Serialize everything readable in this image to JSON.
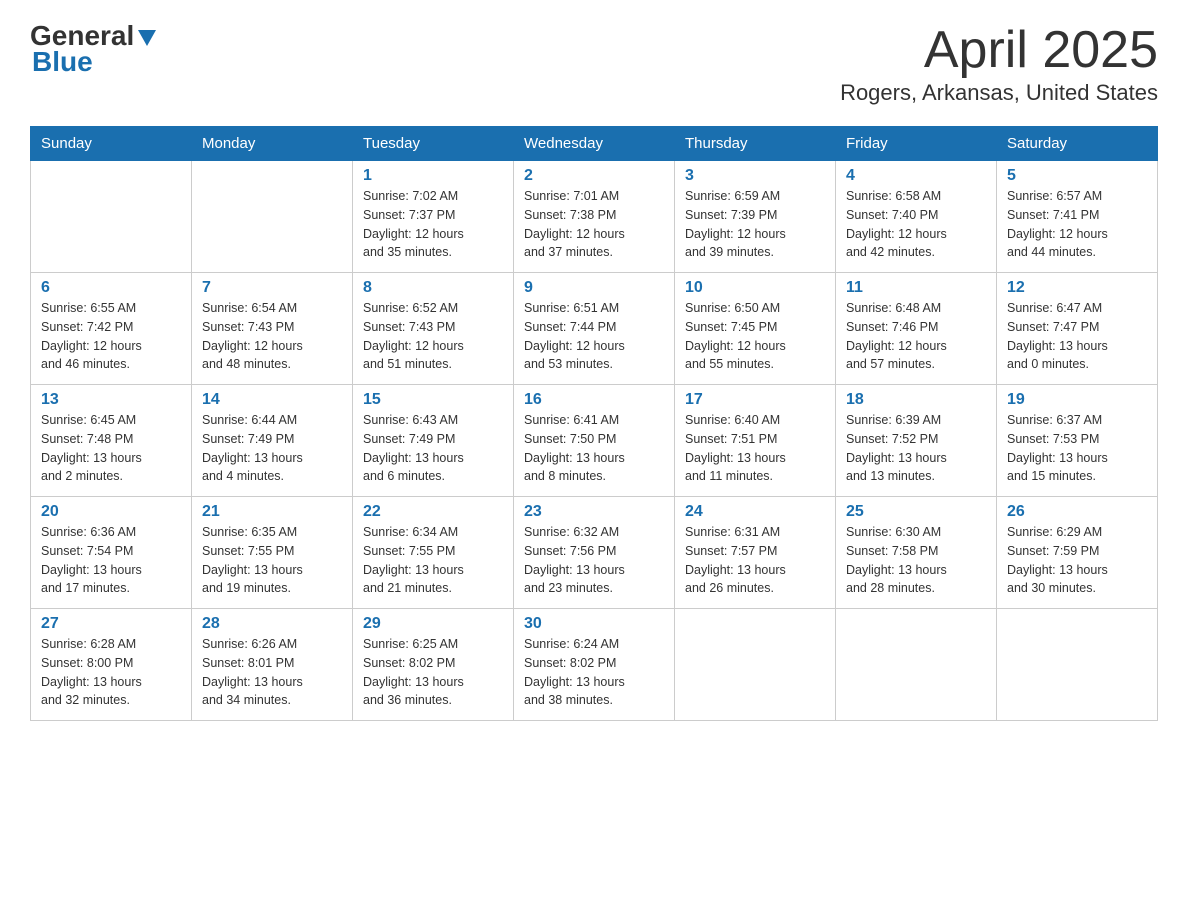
{
  "header": {
    "logo_general": "General",
    "logo_blue": "Blue",
    "month_title": "April 2025",
    "location": "Rogers, Arkansas, United States"
  },
  "days_of_week": [
    "Sunday",
    "Monday",
    "Tuesday",
    "Wednesday",
    "Thursday",
    "Friday",
    "Saturday"
  ],
  "weeks": [
    [
      {
        "day": "",
        "info": ""
      },
      {
        "day": "",
        "info": ""
      },
      {
        "day": "1",
        "info": "Sunrise: 7:02 AM\nSunset: 7:37 PM\nDaylight: 12 hours\nand 35 minutes."
      },
      {
        "day": "2",
        "info": "Sunrise: 7:01 AM\nSunset: 7:38 PM\nDaylight: 12 hours\nand 37 minutes."
      },
      {
        "day": "3",
        "info": "Sunrise: 6:59 AM\nSunset: 7:39 PM\nDaylight: 12 hours\nand 39 minutes."
      },
      {
        "day": "4",
        "info": "Sunrise: 6:58 AM\nSunset: 7:40 PM\nDaylight: 12 hours\nand 42 minutes."
      },
      {
        "day": "5",
        "info": "Sunrise: 6:57 AM\nSunset: 7:41 PM\nDaylight: 12 hours\nand 44 minutes."
      }
    ],
    [
      {
        "day": "6",
        "info": "Sunrise: 6:55 AM\nSunset: 7:42 PM\nDaylight: 12 hours\nand 46 minutes."
      },
      {
        "day": "7",
        "info": "Sunrise: 6:54 AM\nSunset: 7:43 PM\nDaylight: 12 hours\nand 48 minutes."
      },
      {
        "day": "8",
        "info": "Sunrise: 6:52 AM\nSunset: 7:43 PM\nDaylight: 12 hours\nand 51 minutes."
      },
      {
        "day": "9",
        "info": "Sunrise: 6:51 AM\nSunset: 7:44 PM\nDaylight: 12 hours\nand 53 minutes."
      },
      {
        "day": "10",
        "info": "Sunrise: 6:50 AM\nSunset: 7:45 PM\nDaylight: 12 hours\nand 55 minutes."
      },
      {
        "day": "11",
        "info": "Sunrise: 6:48 AM\nSunset: 7:46 PM\nDaylight: 12 hours\nand 57 minutes."
      },
      {
        "day": "12",
        "info": "Sunrise: 6:47 AM\nSunset: 7:47 PM\nDaylight: 13 hours\nand 0 minutes."
      }
    ],
    [
      {
        "day": "13",
        "info": "Sunrise: 6:45 AM\nSunset: 7:48 PM\nDaylight: 13 hours\nand 2 minutes."
      },
      {
        "day": "14",
        "info": "Sunrise: 6:44 AM\nSunset: 7:49 PM\nDaylight: 13 hours\nand 4 minutes."
      },
      {
        "day": "15",
        "info": "Sunrise: 6:43 AM\nSunset: 7:49 PM\nDaylight: 13 hours\nand 6 minutes."
      },
      {
        "day": "16",
        "info": "Sunrise: 6:41 AM\nSunset: 7:50 PM\nDaylight: 13 hours\nand 8 minutes."
      },
      {
        "day": "17",
        "info": "Sunrise: 6:40 AM\nSunset: 7:51 PM\nDaylight: 13 hours\nand 11 minutes."
      },
      {
        "day": "18",
        "info": "Sunrise: 6:39 AM\nSunset: 7:52 PM\nDaylight: 13 hours\nand 13 minutes."
      },
      {
        "day": "19",
        "info": "Sunrise: 6:37 AM\nSunset: 7:53 PM\nDaylight: 13 hours\nand 15 minutes."
      }
    ],
    [
      {
        "day": "20",
        "info": "Sunrise: 6:36 AM\nSunset: 7:54 PM\nDaylight: 13 hours\nand 17 minutes."
      },
      {
        "day": "21",
        "info": "Sunrise: 6:35 AM\nSunset: 7:55 PM\nDaylight: 13 hours\nand 19 minutes."
      },
      {
        "day": "22",
        "info": "Sunrise: 6:34 AM\nSunset: 7:55 PM\nDaylight: 13 hours\nand 21 minutes."
      },
      {
        "day": "23",
        "info": "Sunrise: 6:32 AM\nSunset: 7:56 PM\nDaylight: 13 hours\nand 23 minutes."
      },
      {
        "day": "24",
        "info": "Sunrise: 6:31 AM\nSunset: 7:57 PM\nDaylight: 13 hours\nand 26 minutes."
      },
      {
        "day": "25",
        "info": "Sunrise: 6:30 AM\nSunset: 7:58 PM\nDaylight: 13 hours\nand 28 minutes."
      },
      {
        "day": "26",
        "info": "Sunrise: 6:29 AM\nSunset: 7:59 PM\nDaylight: 13 hours\nand 30 minutes."
      }
    ],
    [
      {
        "day": "27",
        "info": "Sunrise: 6:28 AM\nSunset: 8:00 PM\nDaylight: 13 hours\nand 32 minutes."
      },
      {
        "day": "28",
        "info": "Sunrise: 6:26 AM\nSunset: 8:01 PM\nDaylight: 13 hours\nand 34 minutes."
      },
      {
        "day": "29",
        "info": "Sunrise: 6:25 AM\nSunset: 8:02 PM\nDaylight: 13 hours\nand 36 minutes."
      },
      {
        "day": "30",
        "info": "Sunrise: 6:24 AM\nSunset: 8:02 PM\nDaylight: 13 hours\nand 38 minutes."
      },
      {
        "day": "",
        "info": ""
      },
      {
        "day": "",
        "info": ""
      },
      {
        "day": "",
        "info": ""
      }
    ]
  ]
}
